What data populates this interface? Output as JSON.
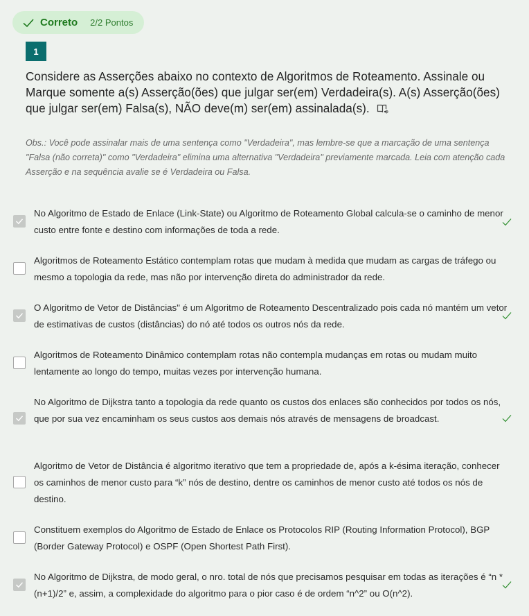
{
  "result": {
    "status": "Correto",
    "points": "2/2 Pontos",
    "icon": "check-icon",
    "color": "#1e7a1e"
  },
  "question": {
    "number": "1",
    "text": "Considere as Asserções abaixo no contexto de Algoritmos de Roteamento. Assinale ou Marque somente a(s) Asserção(ões) que julgar ser(em) Verdadeira(s). A(s) Asserção(ões) que julgar ser(em) Falsa(s), NÃO deve(m) ser(em) assinalada(s).",
    "reader_icon": "immersive-reader-icon",
    "obs": "Obs.: Você pode assinalar mais de uma sentença como \"Verdadeira\", mas lembre-se que a marcação de uma sentença \"Falsa (não correta)\" como \"Verdadeira\" elimina uma alternativa \"Verdadeira\" previamente marcada. Leia com atenção cada Asserção e na sequência avalie se é Verdadeira ou Falsa."
  },
  "options": [
    {
      "text": "No Algoritmo de Estado de Enlace (Link-State) ou Algoritmo de Roteamento Global calcula-se o caminho de menor custo entre fonte e destino com informações de toda a rede.",
      "checked": true,
      "correct": true
    },
    {
      "text": "Algoritmos de Roteamento Estático contemplam rotas que mudam à medida que mudam as cargas de tráfego ou mesmo a topologia da rede, mas não por intervenção direta do administrador da rede.",
      "checked": false,
      "correct": false
    },
    {
      "text": "O Algoritmo de Vetor de Distâncias\" é um Algoritmo de Roteamento Descentralizado pois cada nó mantém um vetor de estimativas de custos (distâncias) do nó até todos os outros nós da rede.",
      "checked": true,
      "correct": true
    },
    {
      "text": "Algoritmos de Roteamento Dinâmico contemplam rotas não contempla mudanças em rotas ou mudam muito lentamente ao longo do tempo, muitas vezes por intervenção humana.",
      "checked": false,
      "correct": false
    },
    {
      "text": "No Algoritmo de Dijkstra tanto a topologia da rede quanto os custos dos enlaces são conhecidos por todos os nós, que por sua vez encaminham os seus custos aos demais nós através de mensagens de broadcast.",
      "checked": true,
      "correct": true
    },
    {
      "text": "Algoritmo de Vetor de Distância é algoritmo iterativo que tem a propriedade de, após a k-ésima iteração, conhecer os caminhos de menor custo para “k” nós de destino, dentre os caminhos de menor custo até todos os nós de destino.",
      "checked": false,
      "correct": false
    },
    {
      "text": "Constituem exemplos do Algoritmo de Estado de Enlace os Protocolos RIP (Routing Information Protocol), BGP (Border Gateway Protocol) e OSPF (Open Shortest Path First).",
      "checked": false,
      "correct": false
    },
    {
      "text": "No Algoritmo de Dijkstra, de modo geral, o nro. total de nós que precisamos pesquisar em todas as iterações é “n * (n+1)/2” e, assim, a complexidade do algoritmo para o pior caso é de ordem “n^2” ou O(n^2).",
      "checked": true,
      "correct": true
    }
  ]
}
